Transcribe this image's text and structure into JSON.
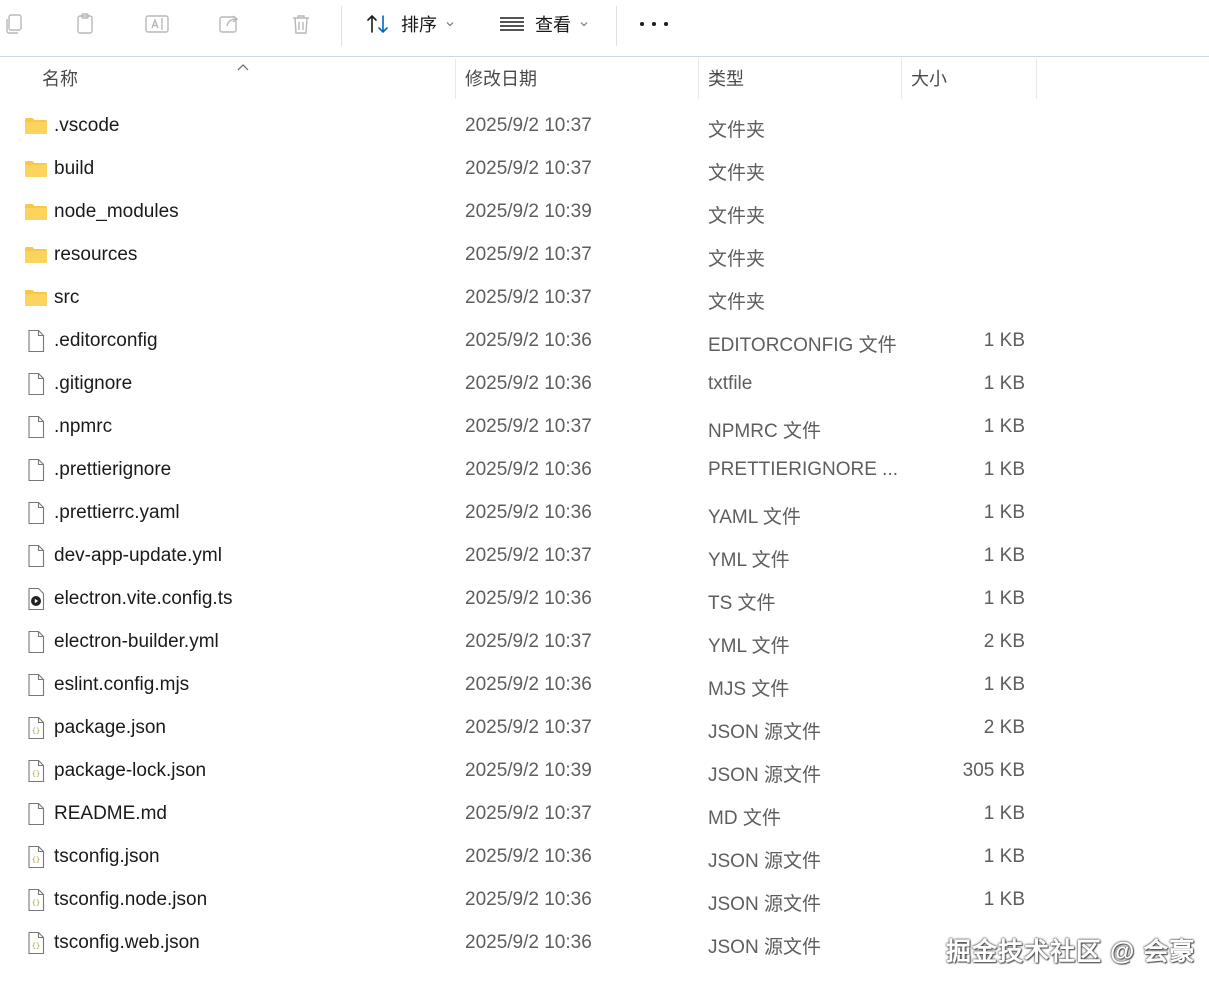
{
  "toolbar": {
    "sort_label": "排序",
    "view_label": "查看",
    "icons": [
      "copy-icon",
      "paste-icon",
      "rename-icon",
      "share-icon",
      "delete-icon",
      "sort-icon",
      "view-icon",
      "more-icon"
    ]
  },
  "columns": {
    "name": "名称",
    "date": "修改日期",
    "type": "类型",
    "size": "大小"
  },
  "files": [
    {
      "name": ".vscode",
      "date": "2025/9/2 10:37",
      "type": "文件夹",
      "size": "",
      "icon": "folder"
    },
    {
      "name": "build",
      "date": "2025/9/2 10:37",
      "type": "文件夹",
      "size": "",
      "icon": "folder"
    },
    {
      "name": "node_modules",
      "date": "2025/9/2 10:39",
      "type": "文件夹",
      "size": "",
      "icon": "folder"
    },
    {
      "name": "resources",
      "date": "2025/9/2 10:37",
      "type": "文件夹",
      "size": "",
      "icon": "folder"
    },
    {
      "name": "src",
      "date": "2025/9/2 10:37",
      "type": "文件夹",
      "size": "",
      "icon": "folder"
    },
    {
      "name": ".editorconfig",
      "date": "2025/9/2 10:36",
      "type": "EDITORCONFIG 文件",
      "size": "1 KB",
      "icon": "file"
    },
    {
      "name": ".gitignore",
      "date": "2025/9/2 10:36",
      "type": "txtfile",
      "size": "1 KB",
      "icon": "file"
    },
    {
      "name": ".npmrc",
      "date": "2025/9/2 10:37",
      "type": "NPMRC 文件",
      "size": "1 KB",
      "icon": "file"
    },
    {
      "name": ".prettierignore",
      "date": "2025/9/2 10:36",
      "type": "PRETTIERIGNORE ...",
      "size": "1 KB",
      "icon": "file"
    },
    {
      "name": ".prettierrc.yaml",
      "date": "2025/9/2 10:36",
      "type": "YAML 文件",
      "size": "1 KB",
      "icon": "file"
    },
    {
      "name": "dev-app-update.yml",
      "date": "2025/9/2 10:37",
      "type": "YML 文件",
      "size": "1 KB",
      "icon": "file"
    },
    {
      "name": "electron.vite.config.ts",
      "date": "2025/9/2 10:36",
      "type": "TS 文件",
      "size": "1 KB",
      "icon": "media"
    },
    {
      "name": "electron-builder.yml",
      "date": "2025/9/2 10:37",
      "type": "YML 文件",
      "size": "2 KB",
      "icon": "file"
    },
    {
      "name": "eslint.config.mjs",
      "date": "2025/9/2 10:36",
      "type": "MJS 文件",
      "size": "1 KB",
      "icon": "file"
    },
    {
      "name": "package.json",
      "date": "2025/9/2 10:37",
      "type": "JSON 源文件",
      "size": "2 KB",
      "icon": "json"
    },
    {
      "name": "package-lock.json",
      "date": "2025/9/2 10:39",
      "type": "JSON 源文件",
      "size": "305 KB",
      "icon": "json"
    },
    {
      "name": "README.md",
      "date": "2025/9/2 10:37",
      "type": "MD 文件",
      "size": "1 KB",
      "icon": "file"
    },
    {
      "name": "tsconfig.json",
      "date": "2025/9/2 10:36",
      "type": "JSON 源文件",
      "size": "1 KB",
      "icon": "json"
    },
    {
      "name": "tsconfig.node.json",
      "date": "2025/9/2 10:36",
      "type": "JSON 源文件",
      "size": "1 KB",
      "icon": "json"
    },
    {
      "name": "tsconfig.web.json",
      "date": "2025/9/2 10:36",
      "type": "JSON 源文件",
      "size": "",
      "icon": "json"
    }
  ],
  "watermark": "掘金技术社区 @ 会豪",
  "colors": {
    "folder": "#f8c847",
    "accent": "#0067c0",
    "toolbar_border": "#c8dde2"
  }
}
